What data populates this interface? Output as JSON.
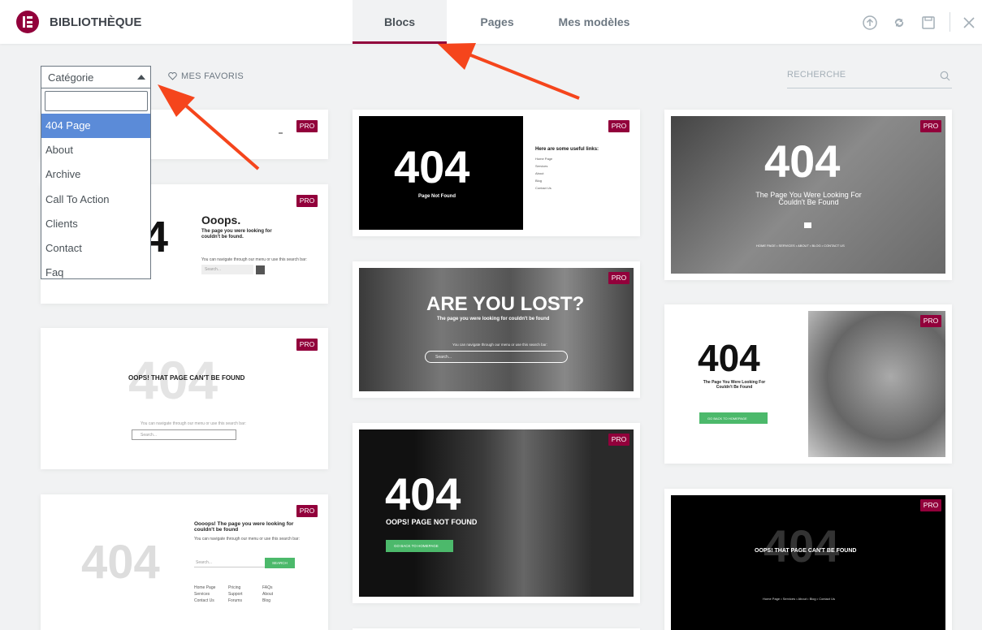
{
  "app": {
    "title": "BIBLIOTHÈQUE"
  },
  "tabs": [
    {
      "label": "Blocs"
    },
    {
      "label": "Pages"
    },
    {
      "label": "Mes modèles"
    }
  ],
  "header_icons": [
    "upload-icon",
    "sync-icon",
    "save-icon",
    "close-icon"
  ],
  "filter": {
    "category_label": "Catégorie",
    "favorites_label": "MES FAVORIS",
    "search_placeholder": "RECHERCHE"
  },
  "dropdown": {
    "search_value": "",
    "options": [
      "404 Page",
      "About",
      "Archive",
      "Call To Action",
      "Clients",
      "Contact",
      "Faq"
    ],
    "selected": "404 Page"
  },
  "badge": "PRO",
  "colors": {
    "brand": "#92003b",
    "selected": "#5b8bd8",
    "arrow": "#f5451c",
    "button_green": "#4cb96b"
  },
  "cards": {
    "c2": {
      "title": "Ooops.",
      "subtitle": "The page you were looking for couldn't be found.",
      "small": "You can navigate through our menu or use this search bar:",
      "search": "Search...",
      "number": "4"
    },
    "c3": {
      "number": "404",
      "title": "OOPS! THAT PAGE CAN'T BE FOUND",
      "small": "You can navigate through our menu or use this search bar:",
      "search": "Search..."
    },
    "c4": {
      "number": "404",
      "title": "Oooops! The page you were looking for couldn't be found",
      "small": "You can navigate through our menu or use this search bar:",
      "search": "Search...",
      "button": "SEARCH",
      "links": [
        "Home Page",
        "Services",
        "Contact Us",
        "Pricing",
        "Support",
        "Forums",
        "FAQs",
        "About",
        "Blog"
      ]
    },
    "c5": {
      "number": "404",
      "subtitle": "Page Not Found",
      "links_title": "Here are some useful links:",
      "links": [
        "Home Page",
        "Services",
        "About",
        "Blog",
        "Contact Us"
      ]
    },
    "c6": {
      "title": "ARE YOU LOST?",
      "subtitle": "The page you were looking for couldn't be found",
      "small": "You can navigate through our menu or use this search bar:",
      "search": "Search..."
    },
    "c7": {
      "number": "404",
      "title": "OOPS! PAGE NOT FOUND",
      "button": "GO BACK TO HOMEPAGE"
    },
    "c8": {
      "number": "404",
      "title": "The Page You Were Looking For Couldn't Be Found",
      "nav": "HOME PAGE  •  SERVICES  •  ABOUT  •  BLOG  •  CONTACT US"
    },
    "c9": {
      "number": "404",
      "title": "The Page You Were Looking For Couldn't Be Found",
      "button": "GO BACK TO HOMEPAGE"
    },
    "c10": {
      "number": "404",
      "title": "OOPS! THAT PAGE CAN'T BE FOUND",
      "nav": "Home Page  •  Services  •  About  •  Blog  •  Contact Us"
    }
  }
}
